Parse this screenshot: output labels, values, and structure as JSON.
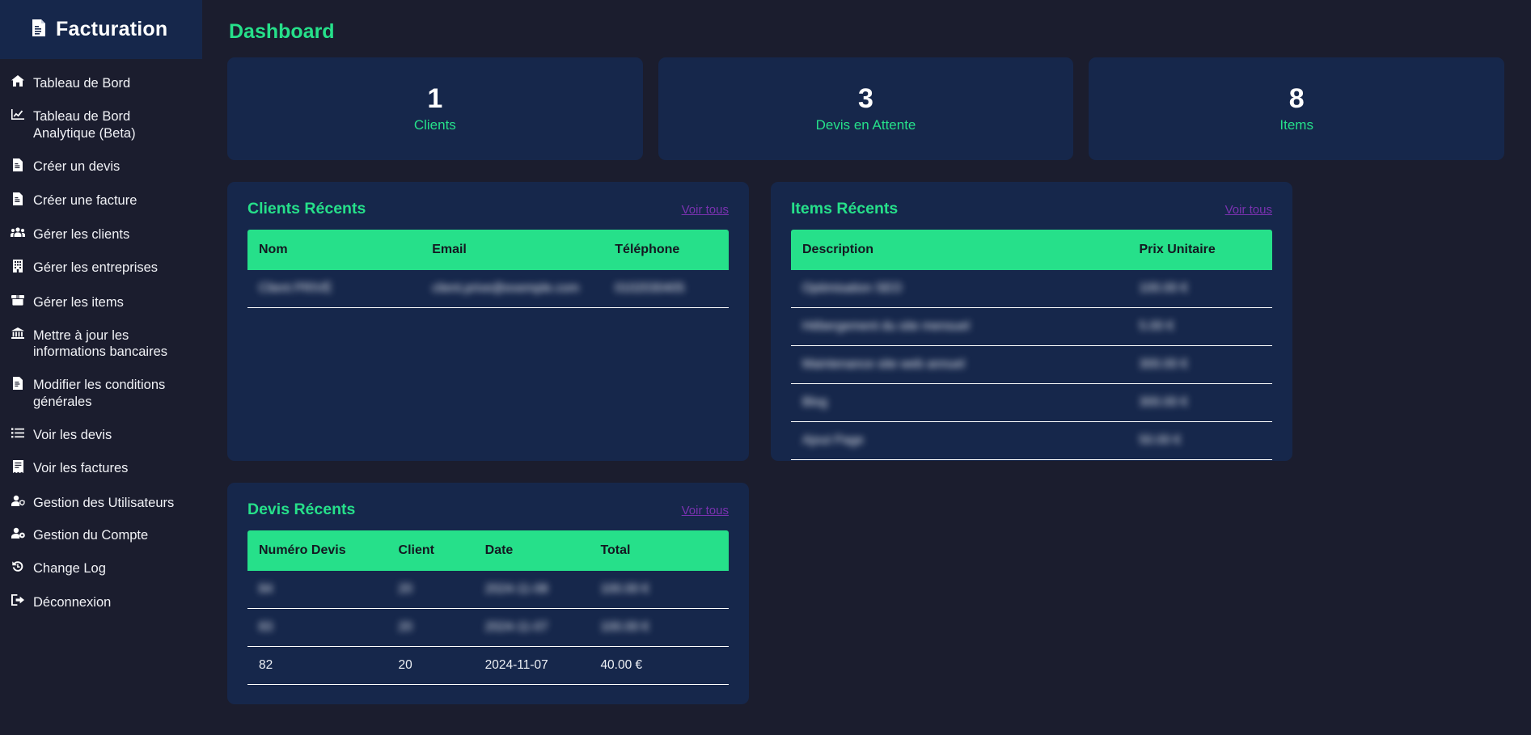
{
  "sidebar": {
    "brand": {
      "icon": "document-invoice-icon",
      "label": "Facturation"
    },
    "items": [
      {
        "icon": "home-icon",
        "glyph": "⌂",
        "label": "Tableau de Bord"
      },
      {
        "icon": "chart-line-icon",
        "glyph": "↗",
        "label": "Tableau de Bord Analytique (Beta)"
      },
      {
        "icon": "file-text-icon",
        "glyph": "὜E",
        "label": "Créer un devis"
      },
      {
        "icon": "file-text-icon",
        "glyph": "὜E",
        "label": "Créer une facture"
      },
      {
        "icon": "users-icon",
        "glyph": "὆5",
        "label": "Gérer les clients"
      },
      {
        "icon": "building-icon",
        "glyph": "Ἶ2",
        "label": "Gérer les entreprises"
      },
      {
        "icon": "box-icon",
        "glyph": "὎6",
        "label": "Gérer les items"
      },
      {
        "icon": "bank-icon",
        "glyph": "ἽB",
        "label": "Mettre à jour les informations bancaires"
      },
      {
        "icon": "file-edit-icon",
        "glyph": "὜E",
        "label": "Modifier les conditions générales"
      },
      {
        "icon": "list-icon",
        "glyph": "☰",
        "label": "Voir les devis"
      },
      {
        "icon": "receipt-icon",
        "glyph": "ᾟE",
        "label": "Voir les factures"
      },
      {
        "icon": "user-shield-icon",
        "glyph": "὆4",
        "label": "Gestion des Utilisateurs"
      },
      {
        "icon": "user-gear-icon",
        "glyph": "὆4",
        "label": "Gestion du Compte"
      },
      {
        "icon": "history-icon",
        "glyph": "↺",
        "label": "Change Log"
      },
      {
        "icon": "logout-icon",
        "glyph": "↪",
        "label": "Déconnexion"
      }
    ]
  },
  "main": {
    "page_title": "Dashboard",
    "stats": [
      {
        "value": "1",
        "label": "Clients"
      },
      {
        "value": "3",
        "label": "Devis en Attente"
      },
      {
        "value": "8",
        "label": "Items"
      }
    ],
    "clients_panel": {
      "title": "Clients Récents",
      "see_all": "Voir tous",
      "columns": [
        "Nom",
        "Email",
        "Téléphone"
      ],
      "rows": [
        {
          "redacted": true,
          "cells": [
            "Client PRIVÉ",
            "client.prive@exemple.com",
            "0102030405"
          ]
        }
      ]
    },
    "items_panel": {
      "title": "Items Récents",
      "see_all": "Voir tous",
      "columns": [
        "Description",
        "Prix Unitaire"
      ],
      "rows": [
        {
          "redacted": true,
          "cells": [
            "Optimisation SEO",
            "100.00 €"
          ]
        },
        {
          "redacted": true,
          "cells": [
            "Hébergement du site mensuel",
            "5.00 €"
          ]
        },
        {
          "redacted": true,
          "cells": [
            "Maintenance site web annuel",
            "300.00 €"
          ]
        },
        {
          "redacted": true,
          "cells": [
            "Blog",
            "300.00 €"
          ]
        },
        {
          "redacted": true,
          "cells": [
            "Ajout Page",
            "50.00 €"
          ]
        }
      ]
    },
    "devis_panel": {
      "title": "Devis Récents",
      "see_all": "Voir tous",
      "columns": [
        "Numéro Devis",
        "Client",
        "Date",
        "Total"
      ],
      "rows": [
        {
          "redacted": true,
          "cells": [
            "84",
            "20",
            "2024-11-08",
            "100.00 €"
          ]
        },
        {
          "redacted": true,
          "cells": [
            "83",
            "20",
            "2024-11-07",
            "100.00 €"
          ]
        },
        {
          "redacted": false,
          "cells": [
            "82",
            "20",
            "2024-11-07",
            "40.00 €"
          ]
        }
      ]
    }
  },
  "colors": {
    "page_background": "#1b1d2e",
    "panel_background": "#16274b",
    "accent_green": "#26e08a",
    "link_purple": "#7a32b0",
    "text_primary": "#eef1f6"
  }
}
